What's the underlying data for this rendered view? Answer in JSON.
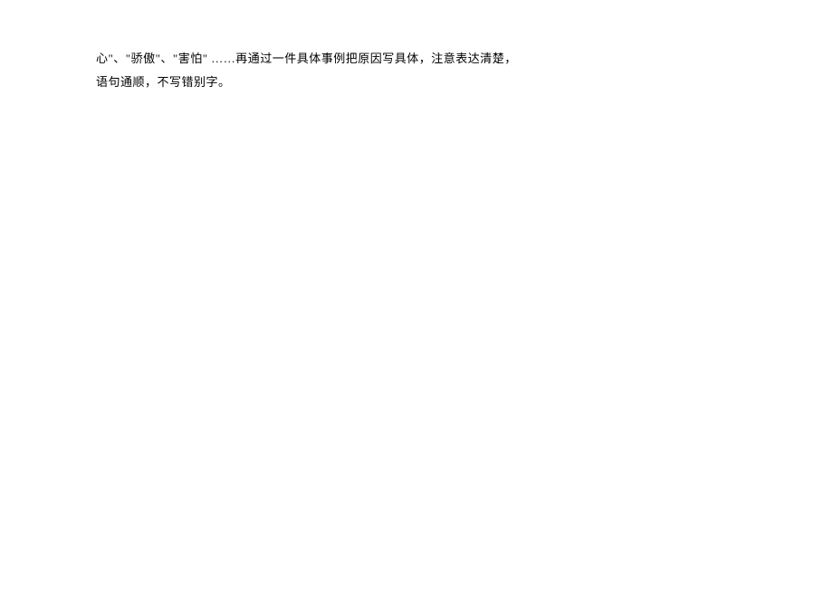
{
  "document": {
    "line1": "心\"、\"骄傲\"、\"害怕\" ……再通过一件具体事例把原因写具体，注意表达清楚，",
    "line2": "语句通顺，不写错别字。"
  }
}
